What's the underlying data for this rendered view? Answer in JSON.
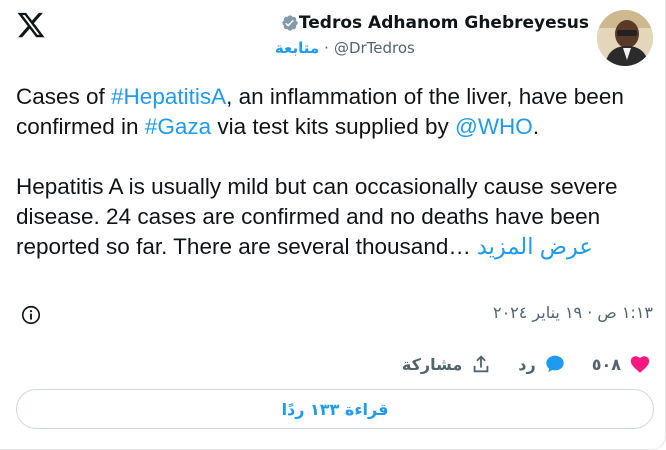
{
  "author": {
    "display_name": "Tedros Adhanom Ghebreyesus",
    "handle": "@DrTedros",
    "separator": "·",
    "follow_label": "متابعة",
    "verified_badge_icon": "verified-badge-icon"
  },
  "tweet": {
    "text_parts": {
      "cases_of": "Cases of ",
      "hashtag_hepatitis": "#HepatitisA",
      "after_hashtag": ", an inflammation of the liver, have been confirmed in ",
      "hashtag_gaza": "#Gaza",
      "after_gaza": " via test kits supplied by ",
      "mention_who": "@WHO",
      "after_who": ".",
      "paragraph2": "Hepatitis A is usually mild but can occasionally cause severe disease. 24 cases are confirmed and no deaths have been reported so far. There are several thousand…",
      "show_more": "عرض المزيد"
    },
    "timestamp": "١:١٣ ص · ١٩ يناير ٢٠٢٤"
  },
  "actions": {
    "like_count": "٥٠٨",
    "reply_label": "رد",
    "share_label": "مشاركة"
  },
  "read_replies_label": "قراءة ١٣٣ ردًا",
  "colors": {
    "accent": "#1d9bf0",
    "like": "#f91880",
    "text": "#0f1419",
    "secondary": "#536471"
  }
}
